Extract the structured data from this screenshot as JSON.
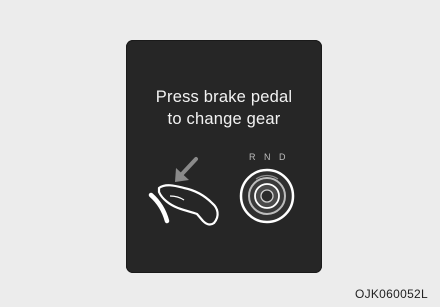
{
  "display": {
    "line1": "Press brake pedal",
    "line2": "to change gear"
  },
  "gear_selector": {
    "positions": [
      "R",
      "N",
      "D"
    ]
  },
  "icons": {
    "arrow": "down-left-arrow-icon",
    "foot": "foot-on-brake-pedal-icon",
    "dial": "rotary-gear-dial-icon"
  },
  "figure_code": "OJK060052L",
  "colors": {
    "panel": "#262626",
    "text": "#f2f2f2",
    "background": "#ececec"
  }
}
